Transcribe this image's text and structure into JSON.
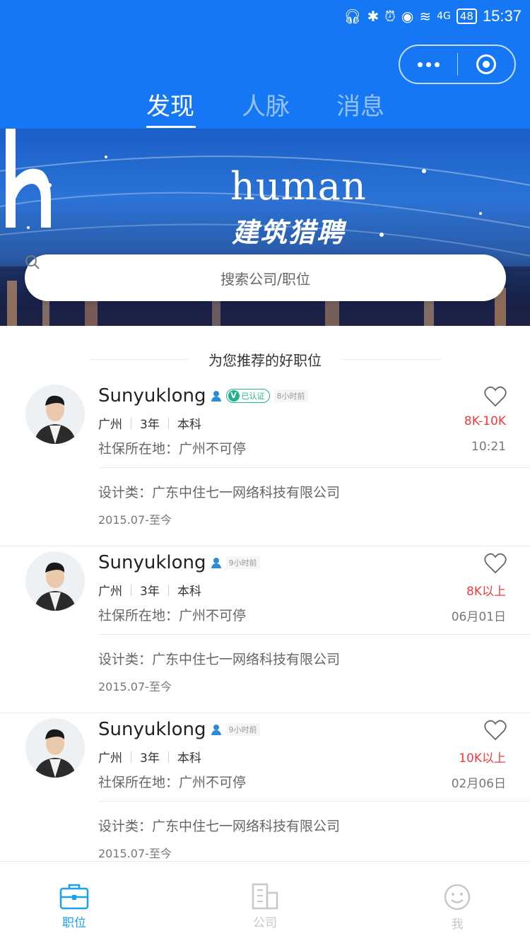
{
  "status_bar": {
    "time": "15:37",
    "battery": "48",
    "network": "4G"
  },
  "capsule": {
    "more_icon": "more-dots-icon",
    "close_icon": "target-circle-icon"
  },
  "tabs": [
    {
      "label": "发现",
      "active": true
    },
    {
      "label": "人脉",
      "active": false
    },
    {
      "label": "消息",
      "active": false
    }
  ],
  "banner": {
    "logo_word": "human",
    "logo_cn": "建筑猎聘"
  },
  "search": {
    "placeholder": "搜索公司/职位"
  },
  "section_title": "为您推荐的好职位",
  "candidates": [
    {
      "name": "Sunyuklong",
      "verified_label": "已认证",
      "time_ago": "8小时前",
      "city": "广州",
      "experience": "3年",
      "education": "本科",
      "social_security": "社保所在地：广州不可停",
      "salary": "8K-10K",
      "posted": "10:21",
      "job": "设计类：广东中住七一网络科技有限公司",
      "period": "2015.07-至今"
    },
    {
      "name": "Sunyuklong",
      "verified_label": "",
      "time_ago": "9小时前",
      "city": "广州",
      "experience": "3年",
      "education": "本科",
      "social_security": "社保所在地：广州不可停",
      "salary": "8K以上",
      "posted": "06月01日",
      "job": "设计类：广东中住七一网络科技有限公司",
      "period": "2015.07-至今"
    },
    {
      "name": "Sunyuklong",
      "verified_label": "",
      "time_ago": "9小时前",
      "city": "广州",
      "experience": "3年",
      "education": "本科",
      "social_security": "社保所在地：广州不可停",
      "salary": "10K以上",
      "posted": "02月06日",
      "job": "设计类：广东中住七一网络科技有限公司",
      "period": "2015.07-至今"
    }
  ],
  "bottom_nav": [
    {
      "label": "职位",
      "icon": "briefcase-icon",
      "active": true
    },
    {
      "label": "公司",
      "icon": "building-icon",
      "active": false
    },
    {
      "label": "我",
      "icon": "smiley-icon",
      "active": false
    }
  ],
  "colors": {
    "primary": "#1677f5",
    "salary": "#f03c3c",
    "verified": "#21b38a",
    "nav_active": "#1aa0f0"
  }
}
